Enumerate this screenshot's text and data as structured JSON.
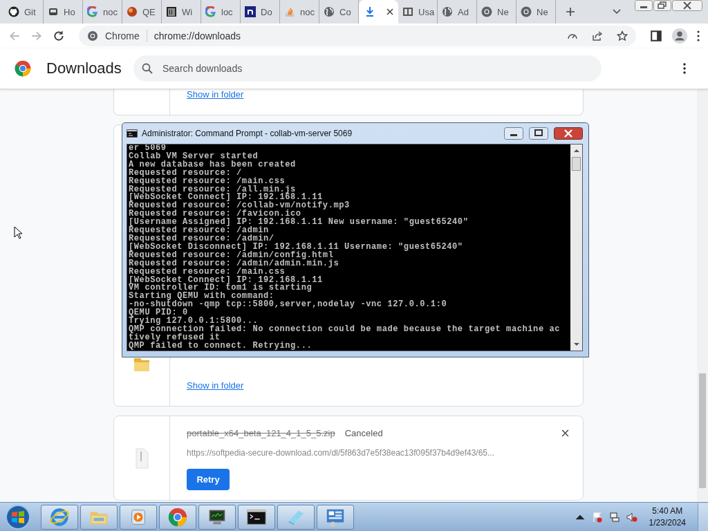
{
  "tabs": [
    {
      "label": "Git",
      "kind": "github",
      "selected": false
    },
    {
      "label": "Ho",
      "kind": "ghost",
      "selected": false
    },
    {
      "label": "noc",
      "kind": "google",
      "selected": false
    },
    {
      "label": "QE",
      "kind": "orb",
      "selected": false
    },
    {
      "label": "Wi",
      "kind": "wiki",
      "selected": false
    },
    {
      "label": "loc",
      "kind": "google",
      "selected": false
    },
    {
      "label": "Do",
      "kind": "nletter",
      "selected": false
    },
    {
      "label": "noc",
      "kind": "stack",
      "selected": false
    },
    {
      "label": "Co",
      "kind": "globe",
      "selected": false
    },
    {
      "kind": "download",
      "selected": true
    },
    {
      "label": "Usa",
      "kind": "book",
      "selected": false
    },
    {
      "label": "Ad",
      "kind": "globe",
      "selected": false
    },
    {
      "label": "Ne",
      "kind": "chrome",
      "selected": false
    },
    {
      "label": "Ne",
      "kind": "chrome",
      "selected": false
    }
  ],
  "address_bar": {
    "site_label": "Chrome",
    "url": "chrome://downloads"
  },
  "page": {
    "title": "Downloads",
    "search": {
      "placeholder": "Search downloads"
    }
  },
  "downloads": [
    {
      "kind": "completed",
      "action_link": "Show in folder"
    },
    {
      "kind": "completed",
      "action_link": "Show in folder"
    },
    {
      "kind": "canceled",
      "file_name": "portable_x64_beta_121_4_1_5_5.zip",
      "status": "Canceled",
      "url": "https://softpedia-secure-download.com/dl/5f863d7e5f38eac13f095f37b4d9ef43/65...",
      "action_button": "Retry"
    }
  ],
  "console_window": {
    "title": "Administrator:  Command Prompt - collab-vm-server  5069",
    "lines": [
      "er 5069",
      "Collab VM Server started",
      "A new database has been created",
      "Requested resource: /",
      "Requested resource: /main.css",
      "Requested resource: /all.min.js",
      "[WebSocket Connect] IP: 192.168.1.11",
      "Requested resource: /collab-vm/notify.mp3",
      "Requested resource: /favicon.ico",
      "[Username Assigned] IP: 192.168.1.11 New username: \"guest65240\"",
      "Requested resource: /admin",
      "Requested resource: /admin/",
      "[WebSocket Disconnect] IP: 192.168.1.11 Username: \"guest65240\"",
      "Requested resource: /admin/config.html",
      "Requested resource: /admin/admin.min.js",
      "Requested resource: /main.css",
      "[WebSocket Connect] IP: 192.168.1.11",
      "VM controller ID: tom1 is starting",
      "Starting QEMU with command:",
      "-no-shutdown -qmp tcp::5800,server,nodelay -vnc 127.0.0.1:0",
      "QEMU PID: 0",
      "Trying 127.0.0.1:5800...",
      "QMP connection failed: No connection could be made because the target machine ac",
      "tively refused it",
      "QMP failed to connect. Retrying..."
    ]
  },
  "taskbar": {
    "apps": [
      {
        "kind": "ie"
      },
      {
        "kind": "explorer"
      },
      {
        "kind": "media"
      },
      {
        "kind": "chrome"
      },
      {
        "kind": "monitor"
      },
      {
        "kind": "cmd"
      },
      {
        "kind": "notepad"
      },
      {
        "kind": "panel"
      }
    ],
    "clock": {
      "time": "5:40 AM",
      "date": "1/23/2024"
    }
  }
}
